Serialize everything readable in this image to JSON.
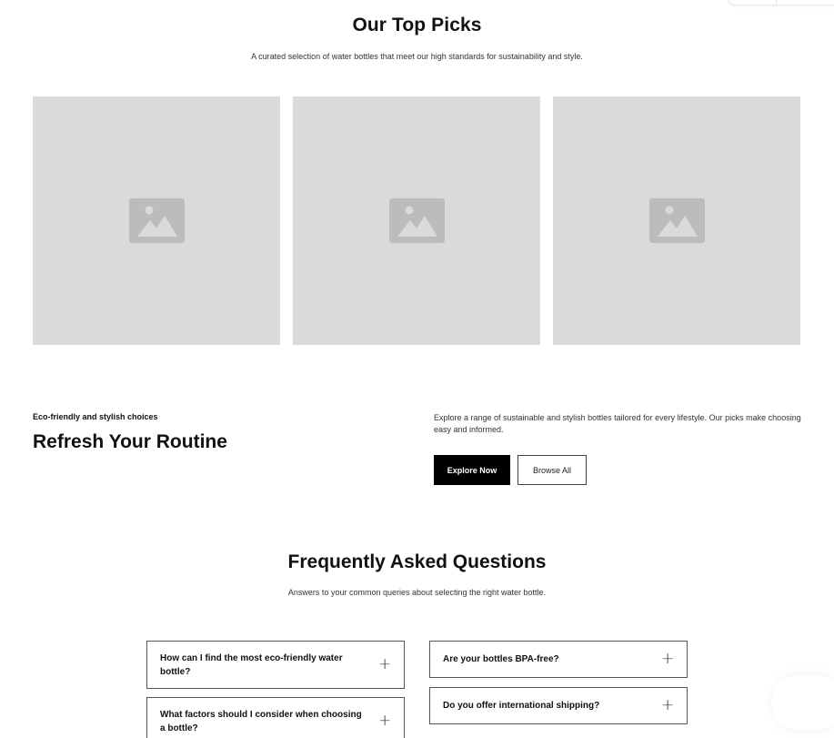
{
  "top_picks": {
    "title": "Our Top Picks",
    "subtitle": "A curated selection of water bottles that meet our high standards for sustainability and style.",
    "images": [
      {
        "icon": "image-placeholder-icon"
      },
      {
        "icon": "image-placeholder-icon"
      },
      {
        "icon": "image-placeholder-icon"
      }
    ]
  },
  "refresh": {
    "eyebrow": "Eco-friendly and stylish choices",
    "heading": "Refresh Your Routine",
    "description": "Explore a range of sustainable and stylish bottles tailored for every lifestyle. Our picks make choosing easy and informed.",
    "primary_button": "Explore Now",
    "secondary_button": "Browse All"
  },
  "faq": {
    "title": "Frequently Asked Questions",
    "subtitle": "Answers to your common queries about selecting the right water bottle.",
    "toggle_icon": "plus-icon",
    "toggle_symbol": "+",
    "items": [
      {
        "question": "How can I find the most eco-friendly water bottle?"
      },
      {
        "question": "What factors should I consider when choosing a bottle?"
      },
      {
        "question": "Are your bottles BPA-free?"
      },
      {
        "question": "Do you offer international shipping?"
      }
    ]
  },
  "colors": {
    "placeholder_bg": "#dadada",
    "placeholder_icon": "#bcbcbc",
    "primary_button_bg": "#000000",
    "text": "#111111"
  }
}
